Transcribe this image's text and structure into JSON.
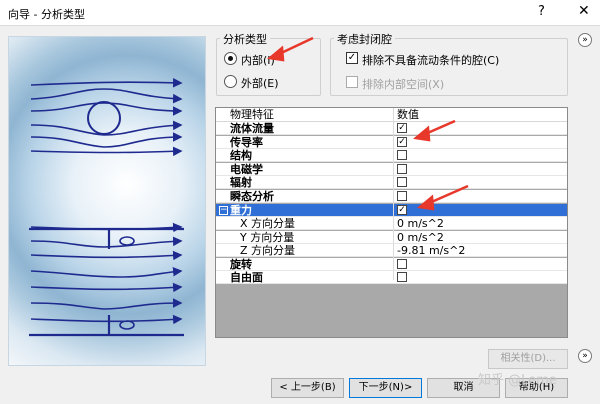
{
  "window": {
    "title": "向导 - 分析类型",
    "help": "?",
    "close": "✕"
  },
  "analysis_type": {
    "title": "分析类型",
    "internal": "内部(I)",
    "external": "外部(E)",
    "selected": "internal"
  },
  "closed_cavities": {
    "title": "考虑封闭腔",
    "exclude_no_flow": "排除不具备流动条件的腔(C)",
    "exclude_internal": "排除内部空间(X)"
  },
  "grid": {
    "headers": [
      "物理特征",
      "数值"
    ],
    "rows": [
      {
        "label": "流体流量",
        "checked": true
      },
      {
        "label": "传导率",
        "checked": true
      },
      {
        "label": "结构",
        "checked": false
      },
      {
        "label": "电磁学",
        "checked": false
      },
      {
        "label": "辐射",
        "checked": false
      },
      {
        "label": "瞬态分析",
        "checked": false
      },
      {
        "label": "重力",
        "checked": true
      },
      {
        "label": "X 方向分量",
        "value": "0 m/s^2"
      },
      {
        "label": "Y 方向分量",
        "value": "0 m/s^2"
      },
      {
        "label": "Z 方向分量",
        "value": "-9.81 m/s^2"
      },
      {
        "label": "旋转",
        "checked": false
      },
      {
        "label": "自由面",
        "checked": false
      }
    ]
  },
  "buttons": {
    "dependency": "相关性(D)...",
    "back": "< 上一步(B)",
    "next": "下一步(N)>",
    "cancel": "取消",
    "help": "帮助(H)"
  },
  "scroll_icons": {
    "top": "»",
    "bottom": "»"
  },
  "watermark": "知乎 @Leme",
  "colors": {
    "selection": "#2f6fd6",
    "arrow": "#e8382b",
    "flow_lines": "#1f2a8f"
  }
}
